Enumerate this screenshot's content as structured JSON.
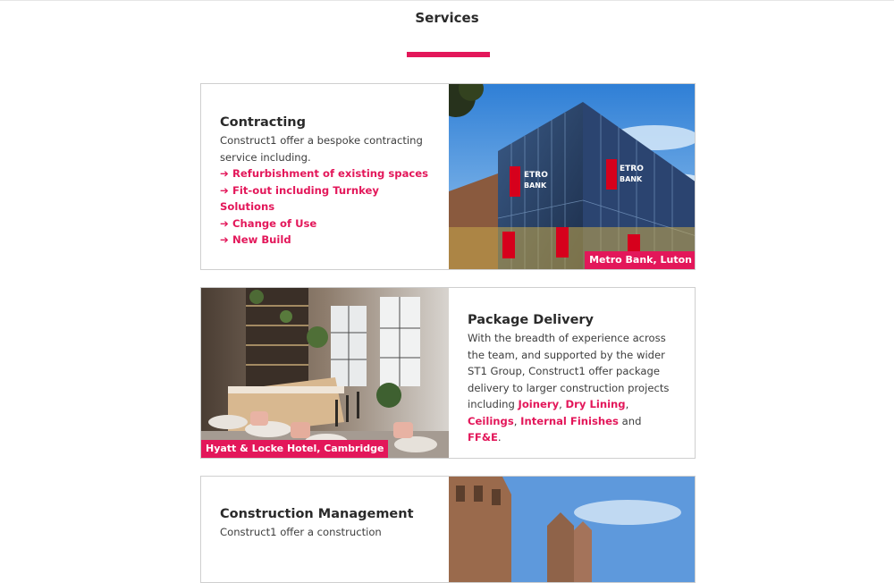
{
  "page": {
    "title": "Services",
    "accent": "#e3175a"
  },
  "cards": [
    {
      "heading": "Contracting",
      "intro": "Construct1 offer a bespoke contracting service including.",
      "items": [
        "Refurbishment of existing spaces",
        "Fit-out including Turnkey Solutions",
        "Change of Use",
        "New Build"
      ],
      "caption": "Metro Bank, Luton",
      "image_sign": "METRO BANK"
    },
    {
      "heading": "Package Delivery",
      "intro": "With the breadth of experience across the team, and supported by the wider ST1 Group, Construct1 offer package delivery to larger construction projects including",
      "links": [
        "Joinery",
        "Dry Lining",
        "Ceilings",
        "Internal Finishes",
        "FF&E"
      ],
      "sep1": ", ",
      "sep_and": " and ",
      "end": ".",
      "caption": "Hyatt & Locke Hotel, Cambridge"
    },
    {
      "heading": "Construction Management",
      "intro": "Construct1 offer a construction"
    }
  ]
}
